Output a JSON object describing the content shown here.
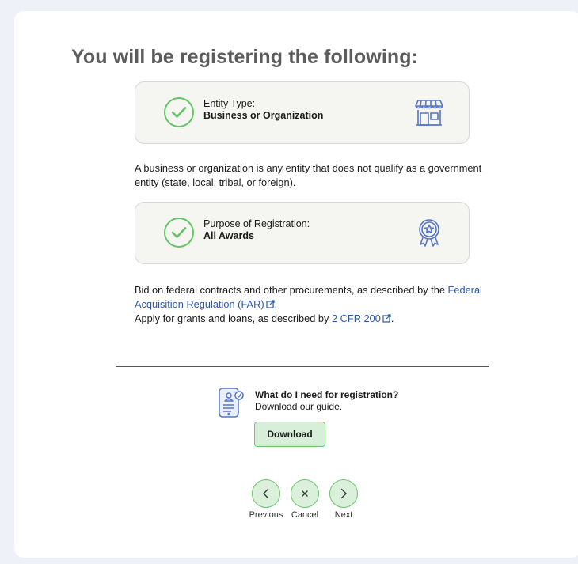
{
  "page": {
    "title": "You will be registering the following:"
  },
  "entity_box": {
    "label": "Entity Type:",
    "value": "Business or Organization",
    "illustration_icon": "storefront-icon"
  },
  "entity_description": "A business or organization is any entity that does not qualify as a government entity (state, local, tribal, or foreign).",
  "purpose_box": {
    "label": "Purpose of Registration:",
    "value": "All Awards",
    "illustration_icon": "award-ribbon-icon"
  },
  "contracts_text": {
    "before": "Bid on federal contracts and other procurements, as described by the ",
    "link": "Federal Acquisition Regulation (FAR)",
    "after": "."
  },
  "grants_text": {
    "before": "Apply for grants and loans, as described by ",
    "link": "2 CFR 200",
    "after": "."
  },
  "guide": {
    "title": "What do I need for registration?",
    "subtitle": "Download our guide.",
    "download_label": "Download"
  },
  "nav": {
    "previous_label": "Previous",
    "cancel_label": "Cancel",
    "next_label": "Next"
  },
  "colors": {
    "accent_green": "#63c463",
    "button_green_bg": "#d7efd9",
    "link_blue": "#2b59a8",
    "box_bg": "#f5f5f2",
    "illustration_blue": "#5575c8"
  }
}
